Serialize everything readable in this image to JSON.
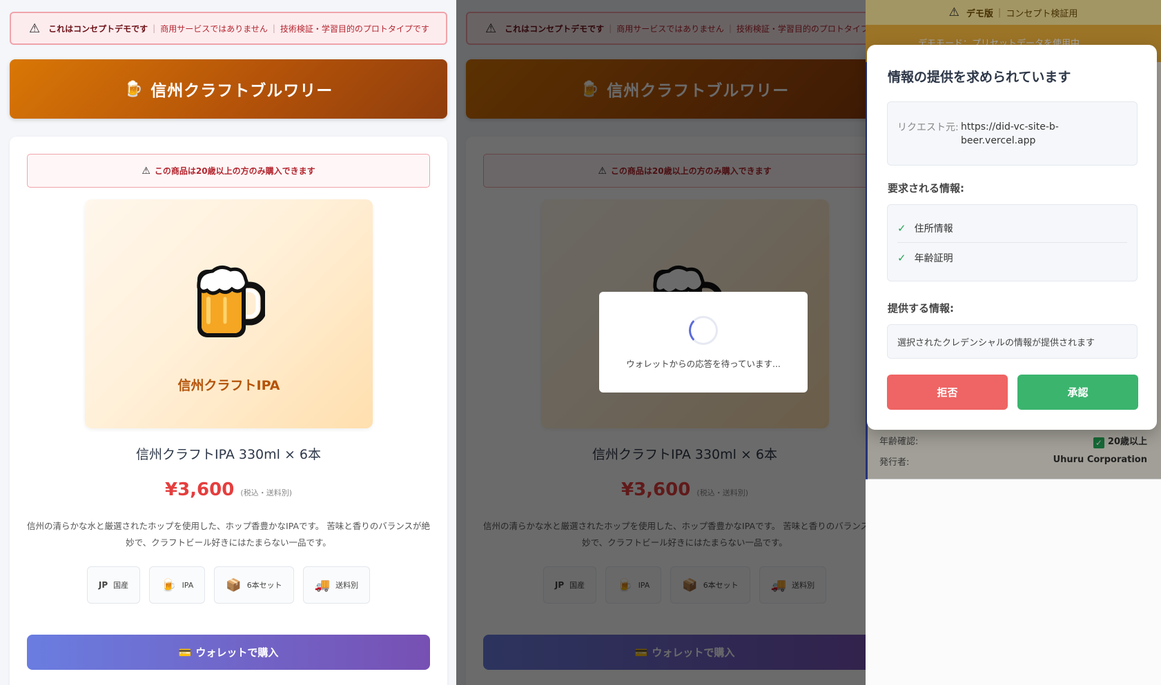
{
  "demo_banner": {
    "bold": "これはコンセプトデモです",
    "item2": "商用サービスではありません",
    "item3": "技術検証・学習目的のプロトタイプです"
  },
  "shop": {
    "name": "信州クラフトブルワリー"
  },
  "product": {
    "age_warning": "この商品は20歳以上の方のみ購入できます",
    "image_label": "信州クラフトIPA",
    "name": "信州クラフトIPA 330ml × 6本",
    "price": "¥3,600",
    "price_note": "(税込・送料別)",
    "description": "信州の清らかな水と厳選されたホップを使用した、ホップ香豊かなIPAです。 苦味と香りのバランスが絶妙で、クラフトビール好きにはたまらない一品です。",
    "tags": [
      {
        "icon": "JP",
        "label": "国産"
      },
      {
        "icon": "beer-mug-icon",
        "label": "IPA"
      },
      {
        "icon": "box-icon",
        "label": "6本セット"
      },
      {
        "icon": "truck-icon",
        "label": "送料別"
      }
    ],
    "buy_button": "ウォレットで購入"
  },
  "loading": {
    "text": "ウォレットからの応答を待っています..."
  },
  "wallet": {
    "demo_label": "デモ版",
    "demo_desc": "コンセプト検証用",
    "mode_text": "デモモード：プリセットデータを使用中",
    "rows": [
      {
        "label": "年齢確認:",
        "value": "20歳以上"
      },
      {
        "label": "発行者:",
        "value": "Uhuru Corporation"
      }
    ]
  },
  "consent": {
    "title": "情報の提供を求められています",
    "origin_label": "リクエスト元:",
    "origin_value": "https://did-vc-site-b-beer.vercel.app",
    "requested_label": "要求される情報:",
    "requested": [
      "住所情報",
      "年齢証明"
    ],
    "provided_label": "提供する情報:",
    "provided_text": "選択されたクレデンシャルの情報が提供されます",
    "reject": "拒否",
    "approve": "承認"
  },
  "colors": {
    "header_gradient_start": "#d97706",
    "price": "#e53e3e",
    "buy_gradient_start": "#6a7de0",
    "buy_gradient_end": "#7750b3",
    "reject": "#ef6464",
    "approve": "#3bb46e"
  }
}
